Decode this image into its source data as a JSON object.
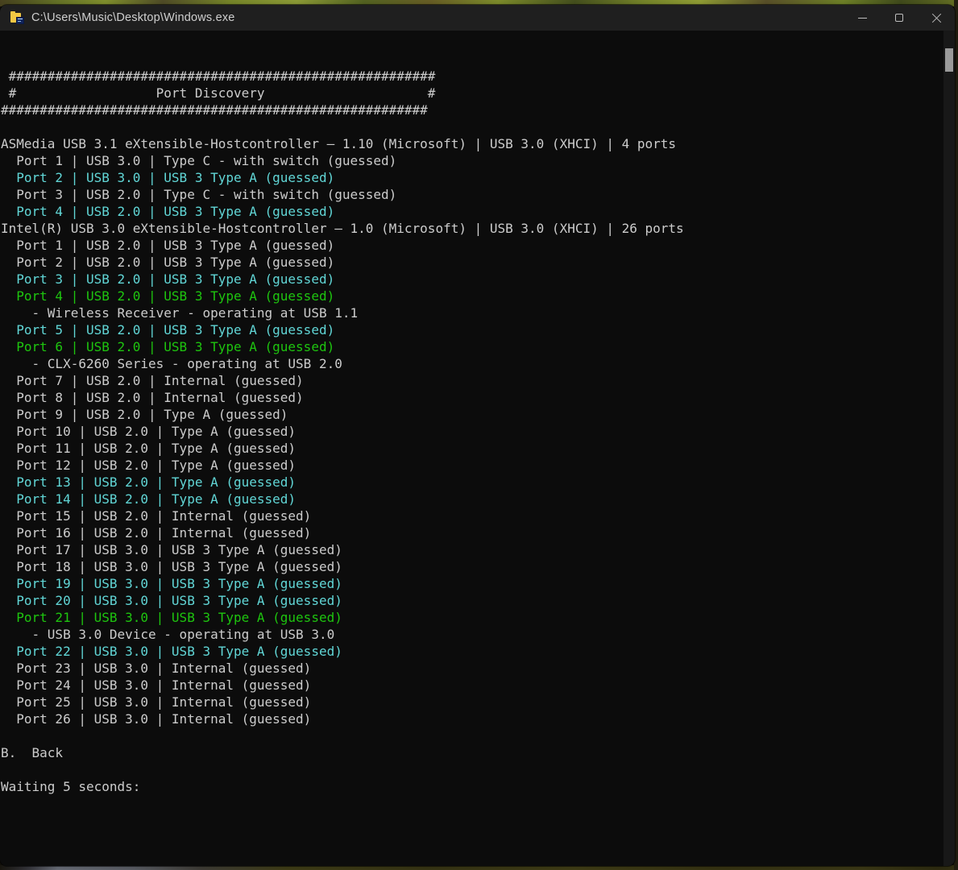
{
  "window": {
    "title": "C:\\Users\\Music\\Desktop\\Windows.exe",
    "controls": {
      "minimize": "minimize",
      "maximize": "maximize",
      "close": "close"
    }
  },
  "colors": {
    "console_bg": "#0c0c0c",
    "titlebar_bg": "#1f1f1f",
    "text_default": "#cccccc",
    "text_cyan": "#61d6d6",
    "text_green": "#1ec50f",
    "scrollbar_thumb": "#9a9a9a"
  },
  "scrollbar": {
    "thumb_position": "near-top"
  },
  "console": {
    "lines": [
      {
        "text": " #######################################################",
        "color": "default"
      },
      {
        "text": " #                  Port Discovery                     #",
        "color": "default"
      },
      {
        "text": "#######################################################",
        "color": "default"
      },
      {
        "text": "",
        "color": "default"
      },
      {
        "text": "ASMedia USB 3.1 eXtensible-Hostcontroller – 1.10 (Microsoft) | USB 3.0 (XHCI) | 4 ports",
        "color": "default"
      },
      {
        "text": "  Port 1 | USB 3.0 | Type C - with switch (guessed)",
        "color": "default"
      },
      {
        "text": "  Port 2 | USB 3.0 | USB 3 Type A (guessed)",
        "color": "cyan"
      },
      {
        "text": "  Port 3 | USB 2.0 | Type C - with switch (guessed)",
        "color": "default"
      },
      {
        "text": "  Port 4 | USB 2.0 | USB 3 Type A (guessed)",
        "color": "cyan"
      },
      {
        "text": "Intel(R) USB 3.0 eXtensible-Hostcontroller – 1.0 (Microsoft) | USB 3.0 (XHCI) | 26 ports",
        "color": "default"
      },
      {
        "text": "  Port 1 | USB 2.0 | USB 3 Type A (guessed)",
        "color": "default"
      },
      {
        "text": "  Port 2 | USB 2.0 | USB 3 Type A (guessed)",
        "color": "default"
      },
      {
        "text": "  Port 3 | USB 2.0 | USB 3 Type A (guessed)",
        "color": "cyan"
      },
      {
        "text": "  Port 4 | USB 2.0 | USB 3 Type A (guessed)",
        "color": "green"
      },
      {
        "text": "    - Wireless Receiver - operating at USB 1.1",
        "color": "default"
      },
      {
        "text": "  Port 5 | USB 2.0 | USB 3 Type A (guessed)",
        "color": "cyan"
      },
      {
        "text": "  Port 6 | USB 2.0 | USB 3 Type A (guessed)",
        "color": "green"
      },
      {
        "text": "    - CLX-6260 Series - operating at USB 2.0",
        "color": "default"
      },
      {
        "text": "  Port 7 | USB 2.0 | Internal (guessed)",
        "color": "default"
      },
      {
        "text": "  Port 8 | USB 2.0 | Internal (guessed)",
        "color": "default"
      },
      {
        "text": "  Port 9 | USB 2.0 | Type A (guessed)",
        "color": "default"
      },
      {
        "text": "  Port 10 | USB 2.0 | Type A (guessed)",
        "color": "default"
      },
      {
        "text": "  Port 11 | USB 2.0 | Type A (guessed)",
        "color": "default"
      },
      {
        "text": "  Port 12 | USB 2.0 | Type A (guessed)",
        "color": "default"
      },
      {
        "text": "  Port 13 | USB 2.0 | Type A (guessed)",
        "color": "cyan"
      },
      {
        "text": "  Port 14 | USB 2.0 | Type A (guessed)",
        "color": "cyan"
      },
      {
        "text": "  Port 15 | USB 2.0 | Internal (guessed)",
        "color": "default"
      },
      {
        "text": "  Port 16 | USB 2.0 | Internal (guessed)",
        "color": "default"
      },
      {
        "text": "  Port 17 | USB 3.0 | USB 3 Type A (guessed)",
        "color": "default"
      },
      {
        "text": "  Port 18 | USB 3.0 | USB 3 Type A (guessed)",
        "color": "default"
      },
      {
        "text": "  Port 19 | USB 3.0 | USB 3 Type A (guessed)",
        "color": "cyan"
      },
      {
        "text": "  Port 20 | USB 3.0 | USB 3 Type A (guessed)",
        "color": "cyan"
      },
      {
        "text": "  Port 21 | USB 3.0 | USB 3 Type A (guessed)",
        "color": "green"
      },
      {
        "text": "    - USB 3.0 Device - operating at USB 3.0",
        "color": "default"
      },
      {
        "text": "  Port 22 | USB 3.0 | USB 3 Type A (guessed)",
        "color": "cyan"
      },
      {
        "text": "  Port 23 | USB 3.0 | Internal (guessed)",
        "color": "default"
      },
      {
        "text": "  Port 24 | USB 3.0 | Internal (guessed)",
        "color": "default"
      },
      {
        "text": "  Port 25 | USB 3.0 | Internal (guessed)",
        "color": "default"
      },
      {
        "text": "  Port 26 | USB 3.0 | Internal (guessed)",
        "color": "default"
      },
      {
        "text": "",
        "color": "default"
      },
      {
        "text": "B.  Back",
        "color": "default"
      },
      {
        "text": "",
        "color": "default"
      },
      {
        "text": "Waiting 5 seconds:",
        "color": "default"
      }
    ]
  }
}
